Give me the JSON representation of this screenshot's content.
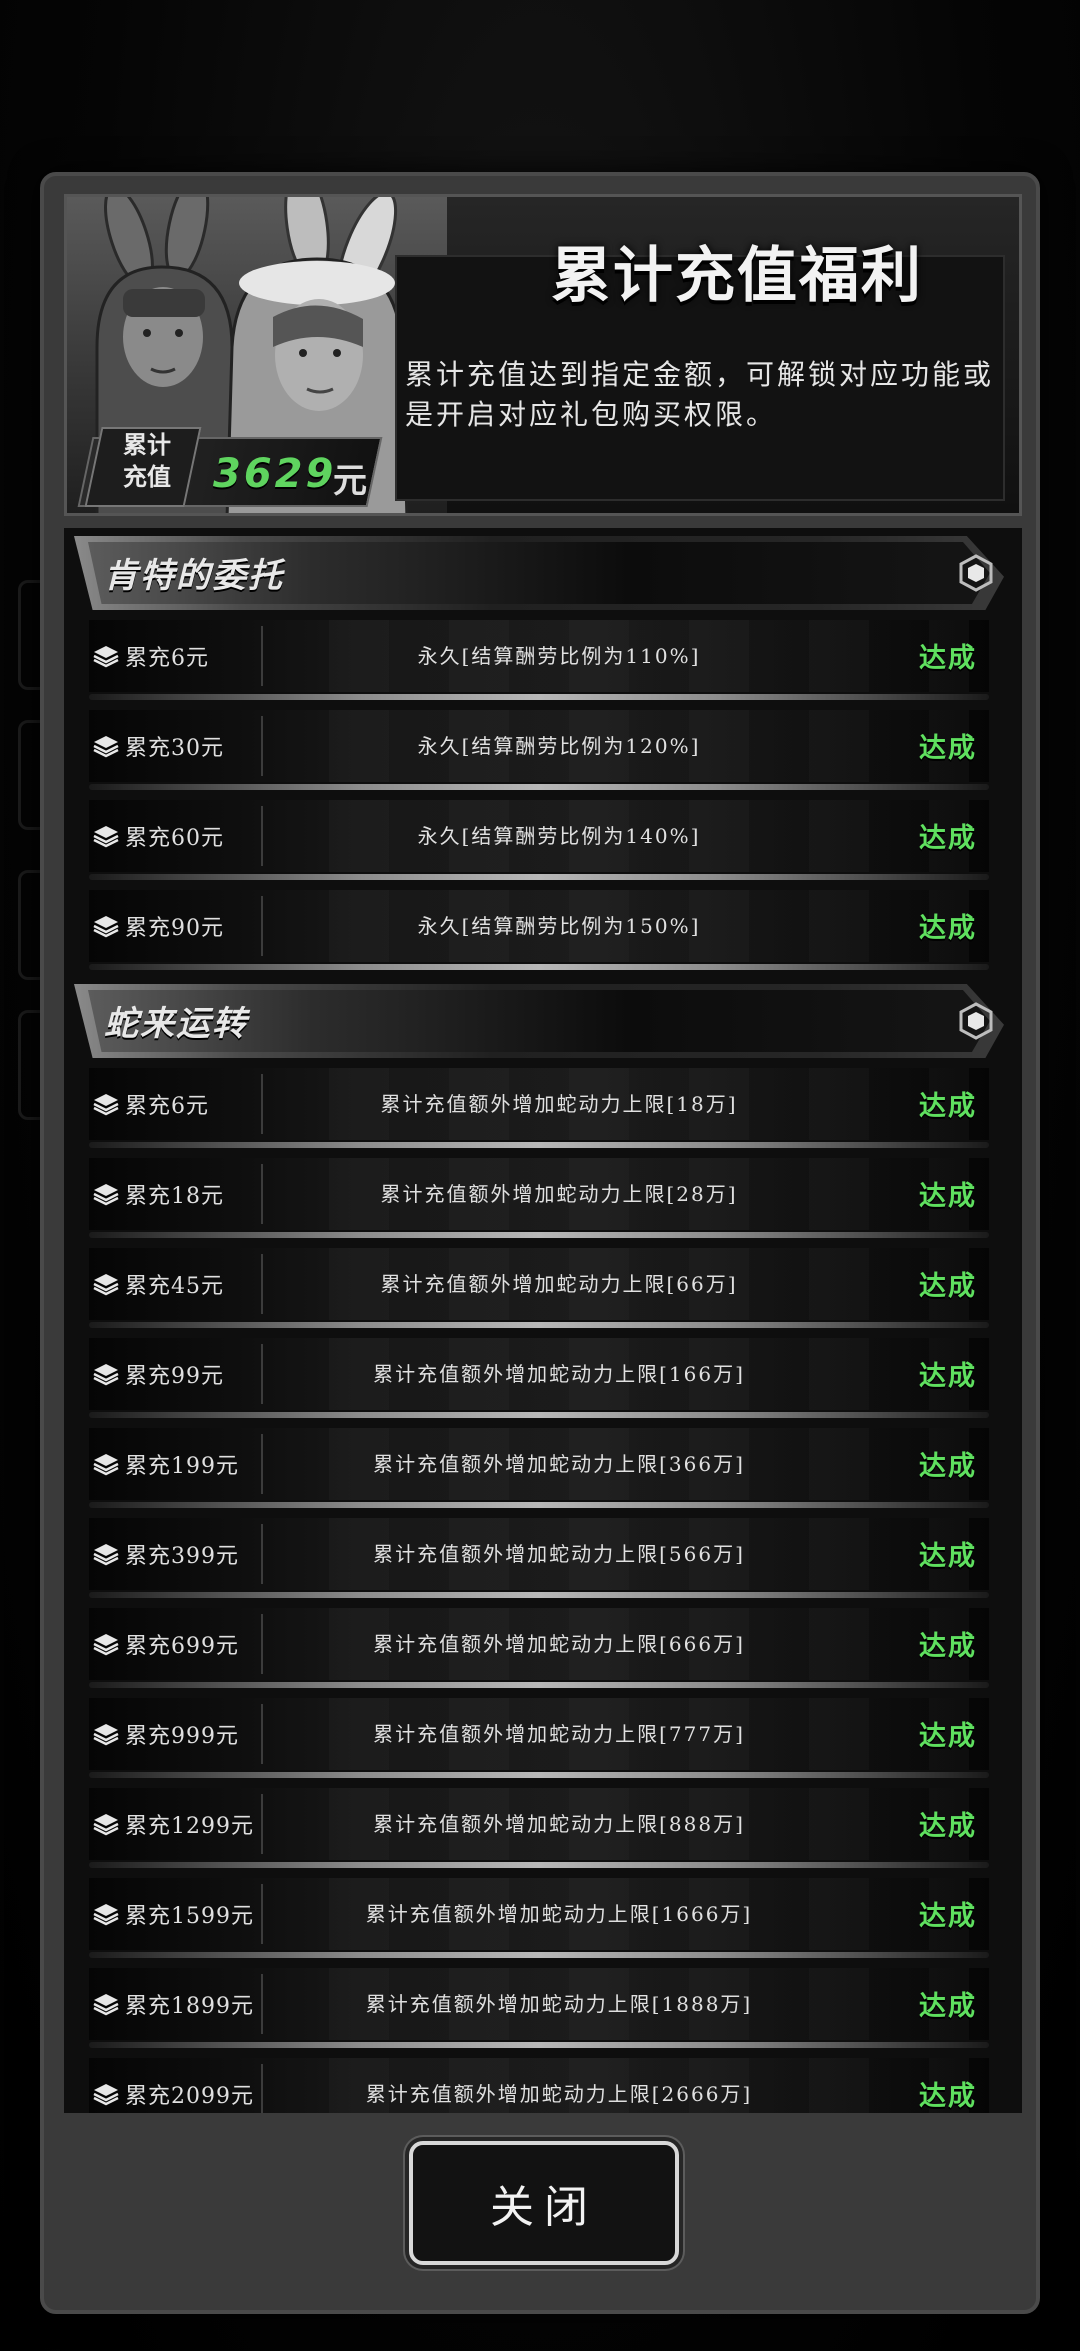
{
  "header": {
    "title": "累计充值福利",
    "description": "累计充值达到指定金额，可解锁对应功能或是开启对应礼包购买权限。",
    "total_label_line1": "累计",
    "total_label_line2": "充值",
    "total_value": "3629",
    "total_unit": "元"
  },
  "sections": [
    {
      "title": "肯特的委托",
      "rows": [
        {
          "tier": "累充6元",
          "reward": "永久[结算酬劳比例为110%]",
          "status": "达成"
        },
        {
          "tier": "累充30元",
          "reward": "永久[结算酬劳比例为120%]",
          "status": "达成"
        },
        {
          "tier": "累充60元",
          "reward": "永久[结算酬劳比例为140%]",
          "status": "达成"
        },
        {
          "tier": "累充90元",
          "reward": "永久[结算酬劳比例为150%]",
          "status": "达成"
        }
      ]
    },
    {
      "title": "蛇来运转",
      "rows": [
        {
          "tier": "累充6元",
          "reward": "累计充值额外增加蛇动力上限[18万]",
          "status": "达成"
        },
        {
          "tier": "累充18元",
          "reward": "累计充值额外增加蛇动力上限[28万]",
          "status": "达成"
        },
        {
          "tier": "累充45元",
          "reward": "累计充值额外增加蛇动力上限[66万]",
          "status": "达成"
        },
        {
          "tier": "累充99元",
          "reward": "累计充值额外增加蛇动力上限[166万]",
          "status": "达成"
        },
        {
          "tier": "累充199元",
          "reward": "累计充值额外增加蛇动力上限[366万]",
          "status": "达成"
        },
        {
          "tier": "累充399元",
          "reward": "累计充值额外增加蛇动力上限[566万]",
          "status": "达成"
        },
        {
          "tier": "累充699元",
          "reward": "累计充值额外增加蛇动力上限[666万]",
          "status": "达成"
        },
        {
          "tier": "累充999元",
          "reward": "累计充值额外增加蛇动力上限[777万]",
          "status": "达成"
        },
        {
          "tier": "累充1299元",
          "reward": "累计充值额外增加蛇动力上限[888万]",
          "status": "达成"
        },
        {
          "tier": "累充1599元",
          "reward": "累计充值额外增加蛇动力上限[1666万]",
          "status": "达成"
        },
        {
          "tier": "累充1899元",
          "reward": "累计充值额外增加蛇动力上限[1888万]",
          "status": "达成"
        },
        {
          "tier": "累充2099元",
          "reward": "累计充值额外增加蛇动力上限[2666万]",
          "status": "达成"
        }
      ]
    }
  ],
  "close_button": {
    "label": "关闭"
  },
  "colors": {
    "achieved": "#5fe05f",
    "total_value": "#5fd45f",
    "panel": "#3a3a3a"
  },
  "icons": {
    "row": "stack-layers-icon",
    "section": "hexagon-icon"
  }
}
